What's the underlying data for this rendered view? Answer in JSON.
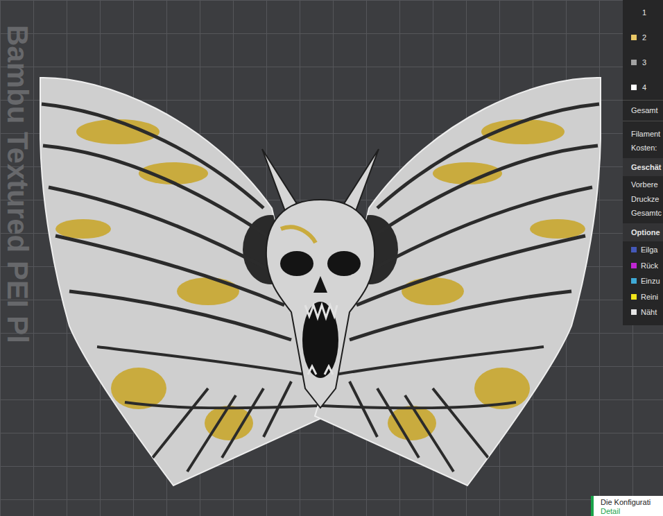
{
  "plate": {
    "watermark": "Bambu Textured PEI Pl"
  },
  "legend": [
    {
      "label": "1"
    },
    {
      "label": "2",
      "color": "#e8c766"
    },
    {
      "label": "3",
      "color": "#a3a3a3"
    },
    {
      "label": "4",
      "color": "#ffffff"
    }
  ],
  "total": "Gesamt",
  "filament": [
    "Filament",
    "Kosten:"
  ],
  "estimate": {
    "header": "Geschät",
    "rows": [
      "Vorbere",
      "Druckze",
      "Gesamtc"
    ]
  },
  "options": {
    "header": "Optione",
    "items": [
      {
        "label": "Eilga",
        "color": "#4458b8"
      },
      {
        "label": "Rück",
        "color": "#c026d3"
      },
      {
        "label": "Einzu",
        "color": "#3fa9d6"
      },
      {
        "label": "Reini",
        "color": "#f2e51a"
      },
      {
        "label": "Näht",
        "color": "#e5e5e5"
      }
    ]
  },
  "notification": {
    "text": "Die Konfigurati",
    "link": "Detail"
  }
}
